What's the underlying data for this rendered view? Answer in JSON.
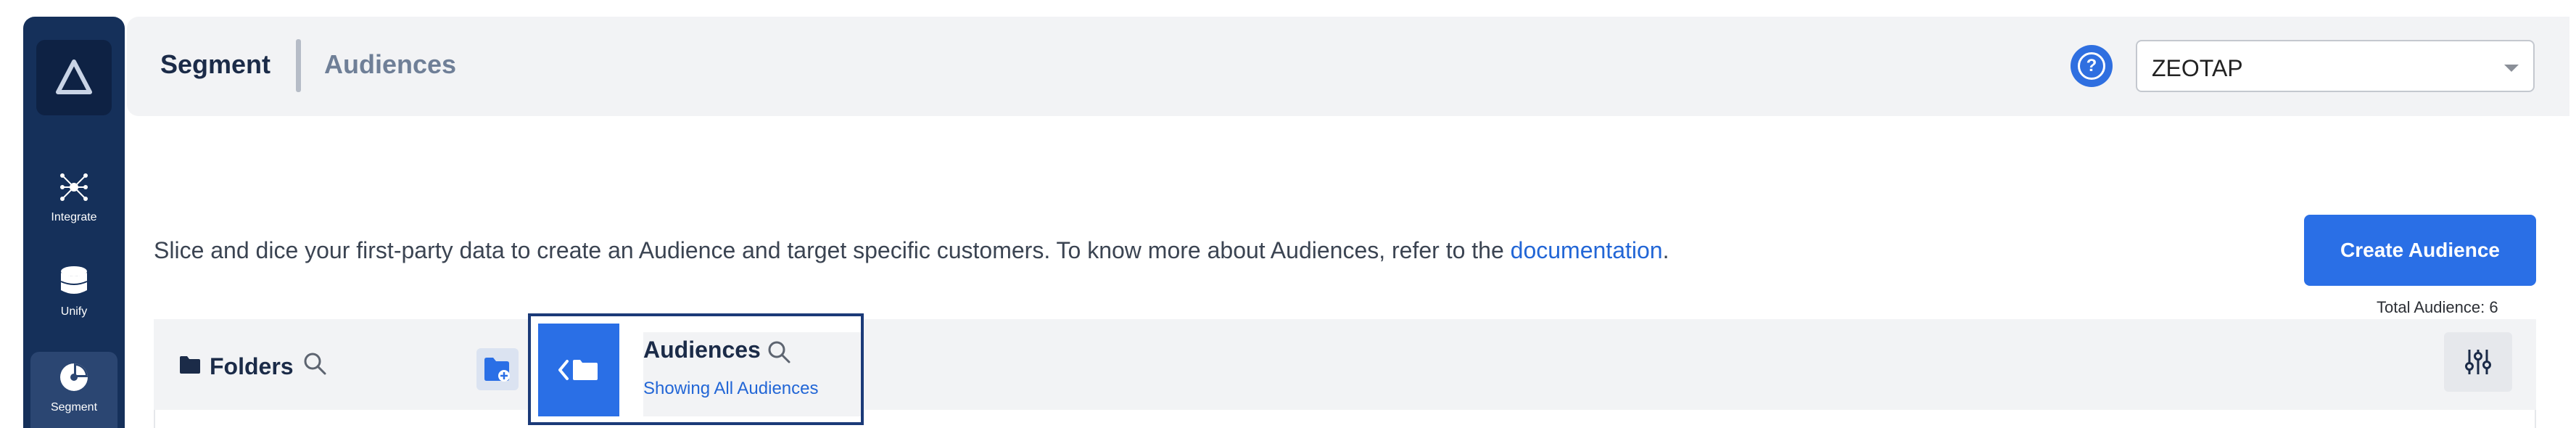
{
  "sidebar": {
    "logo": "logo-icon",
    "items": [
      {
        "label": "Integrate",
        "icon": "network-icon"
      },
      {
        "label": "Unify",
        "icon": "database-icon"
      },
      {
        "label": "Segment",
        "icon": "pie-chart-icon",
        "active": true
      }
    ]
  },
  "header": {
    "title": "Segment",
    "subtitle": "Audiences",
    "help_icon": "help-icon",
    "org_select": {
      "value": "ZEOTAP"
    }
  },
  "main": {
    "description_prefix": "Slice and dice your first-party data to create an Audience and target specific customers. To know more about Audiences, refer to the ",
    "description_link": "documentation",
    "description_suffix": ".",
    "create_button": "Create Audience",
    "total_audience": "Total Audience: 6",
    "folders_label": "Folders",
    "audiences_title": "Audiences",
    "audiences_subtitle": "Showing All Audiences"
  },
  "colors": {
    "sidebar": "#15305a",
    "primary": "#2a6fe6",
    "header_bg": "#f2f3f5",
    "link": "#2266d6"
  }
}
